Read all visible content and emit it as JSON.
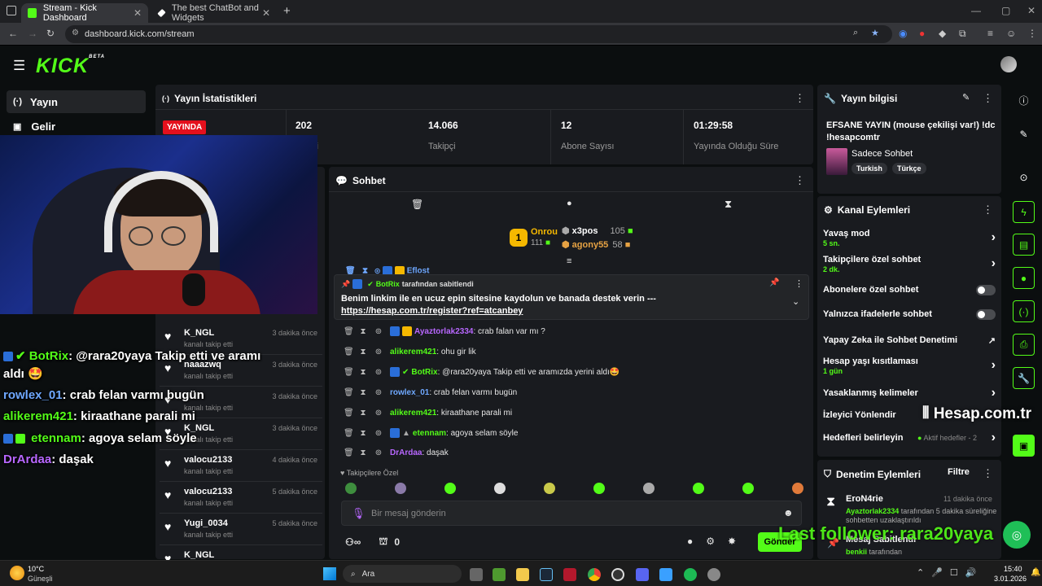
{
  "browser": {
    "tabs": [
      {
        "title": "Stream - Kick Dashboard"
      },
      {
        "title": "The best ChatBot and Widgets"
      }
    ],
    "new_tab": "+",
    "url": "dashboard.kick.com/stream"
  },
  "header": {
    "logo": "KICK",
    "logo_tag": "BETA"
  },
  "sidebar": {
    "items": [
      {
        "label": "Yayın"
      },
      {
        "label": "Gelir"
      }
    ]
  },
  "stats": {
    "title": "Yayın İstatistikleri",
    "live_badge": "YAYINDA",
    "viewers_value": "202",
    "viewers_label": "ci",
    "followers_value": "14.066",
    "followers_label": "Takipçi",
    "subs_value": "12",
    "subs_label": "Abone Sayısı",
    "duration_value": "01:29:58",
    "duration_label": "Yayında Olduğu Süre"
  },
  "overlay_chat": [
    {
      "user": "BotRix",
      "text": ": @rara20yaya Takip etti ve aramı",
      "color": "#53fc18"
    },
    {
      "user": "",
      "text": "aldı 🤩",
      "color": "#ffffff"
    },
    {
      "user": "rowlex_01",
      "text": ": crab felan varmı bugün",
      "color": "#6fa8ff"
    },
    {
      "user": "alikerem421",
      "text": ": kiraathane parali mi",
      "color": "#53fc18"
    },
    {
      "user": "etennam",
      "text": ": agoya selam söyle",
      "color": "#53fc18"
    },
    {
      "user": "DrArdaa",
      "text": ": daşak",
      "color": "#b867ff"
    }
  ],
  "followers": [
    {
      "name": "K_NGL",
      "sub": "kanalı takip etti",
      "time": "3 dakika önce"
    },
    {
      "name": "naaazwq",
      "sub": "kanalı takip etti",
      "time": "3 dakika önce"
    },
    {
      "name": "",
      "sub": "kanalı takip etti",
      "time": "3 dakika önce"
    },
    {
      "name": "K_NGL",
      "sub": "kanalı takip etti",
      "time": "3 dakika önce"
    },
    {
      "name": "valocu2133",
      "sub": "kanalı takip etti",
      "time": "4 dakika önce"
    },
    {
      "name": "valocu2133",
      "sub": "kanalı takip etti",
      "time": "5 dakika önce"
    },
    {
      "name": "Yugi_0034",
      "sub": "kanalı takip etti",
      "time": "5 dakika önce"
    },
    {
      "name": "K_NGL",
      "sub": "",
      "time": ""
    }
  ],
  "chat": {
    "title": "Sohbet",
    "top_gifters": [
      {
        "name": "Onrou",
        "count": "111"
      },
      {
        "name": "x3pos",
        "count": "105"
      },
      {
        "name": "agony55",
        "count": "58"
      }
    ],
    "pinned_by": "BotRix",
    "pinned_by_suffix": "tarafından sabitlendi",
    "pinned_text": "Benim linkim ile en ucuz epin sitesine kaydolun ve banada destek verin --- ",
    "pinned_link": "https://hesap.com.tr/register?ref=atcanbey",
    "partial_user": "Eflost",
    "messages": [
      {
        "user": "Ayaztorlak2334",
        "text": ": crab falan var mı ?",
        "color": "#b867ff"
      },
      {
        "user": "alikerem421",
        "text": ": ohu gir lik",
        "color": "#53fc18"
      },
      {
        "user": "BotRix",
        "text": ": @rara20yaya Takip etti ve aramızda yerini aldı🤩",
        "color": "#53fc18"
      },
      {
        "user": "rowlex_01",
        "text": ": crab felan varmı bugün",
        "color": "#6fa8ff"
      },
      {
        "user": "alikerem421",
        "text": ": kiraathane parali mi",
        "color": "#53fc18"
      },
      {
        "user": "etennam",
        "text": ": agoya selam söyle",
        "color": "#53fc18"
      },
      {
        "user": "DrArdaa",
        "text": ": daşak",
        "color": "#b867ff"
      }
    ],
    "emote_section": "Takipçilere Özel",
    "input_placeholder": "Bir mesaj gönderin",
    "points": "0",
    "send_label": "Gönder"
  },
  "stream_info": {
    "title": "Yayın bilgisi",
    "stream_title": "EFSANE YAYIN (mouse çekilişi var!) !dc !hesapcomtr",
    "category": "Sadece Sohbet",
    "tags": [
      "Turkish",
      "Türkçe"
    ]
  },
  "channel_actions": {
    "title": "Kanal Eylemleri",
    "items": [
      {
        "label": "Yavaş mod",
        "sub": "5 sn."
      },
      {
        "label": "Takipçilere özel sohbet",
        "sub": "2 dk."
      },
      {
        "label": "Abonelere özel sohbet",
        "sub": ""
      },
      {
        "label": "Yalnızca ifadelerle sohbet",
        "sub": ""
      },
      {
        "label": "Yapay Zeka ile Sohbet Denetimi",
        "sub": ""
      },
      {
        "label": "Hesap yaşı kısıtlaması",
        "sub": "1 gün"
      },
      {
        "label": "Yasaklanmış kelimeler",
        "sub": ""
      },
      {
        "label": "İzleyici Yönlendir",
        "sub": ""
      },
      {
        "label": "Hedefleri belirleyin",
        "sub": ""
      }
    ],
    "goals_status": "Aktif hedefler - 2"
  },
  "moderation": {
    "title": "Denetim Eylemleri",
    "filter": "Filtre",
    "entries": [
      {
        "user": "EroN4rie",
        "time": "11 dakika önce",
        "target": "Ayaztorlak2334",
        "text": " tarafından 5 dakika süreliğine sohbetten uzaklaştırıldı"
      },
      {
        "user": "Mesaj Sabitlendi",
        "time": "",
        "target": "benkii",
        "text": " tarafından"
      }
    ]
  },
  "overlay": {
    "watermark": "Hesap.com.tr",
    "last_follower": "Last follower: rara20yaya"
  },
  "taskbar": {
    "weather_temp": "10°C",
    "weather_desc": "Güneşli",
    "search": "Ara",
    "time": "15:40",
    "date": "3.01.2026"
  },
  "colors": {
    "brand": "#53fc18",
    "live": "#e4101d",
    "panel": "#191b1f"
  }
}
